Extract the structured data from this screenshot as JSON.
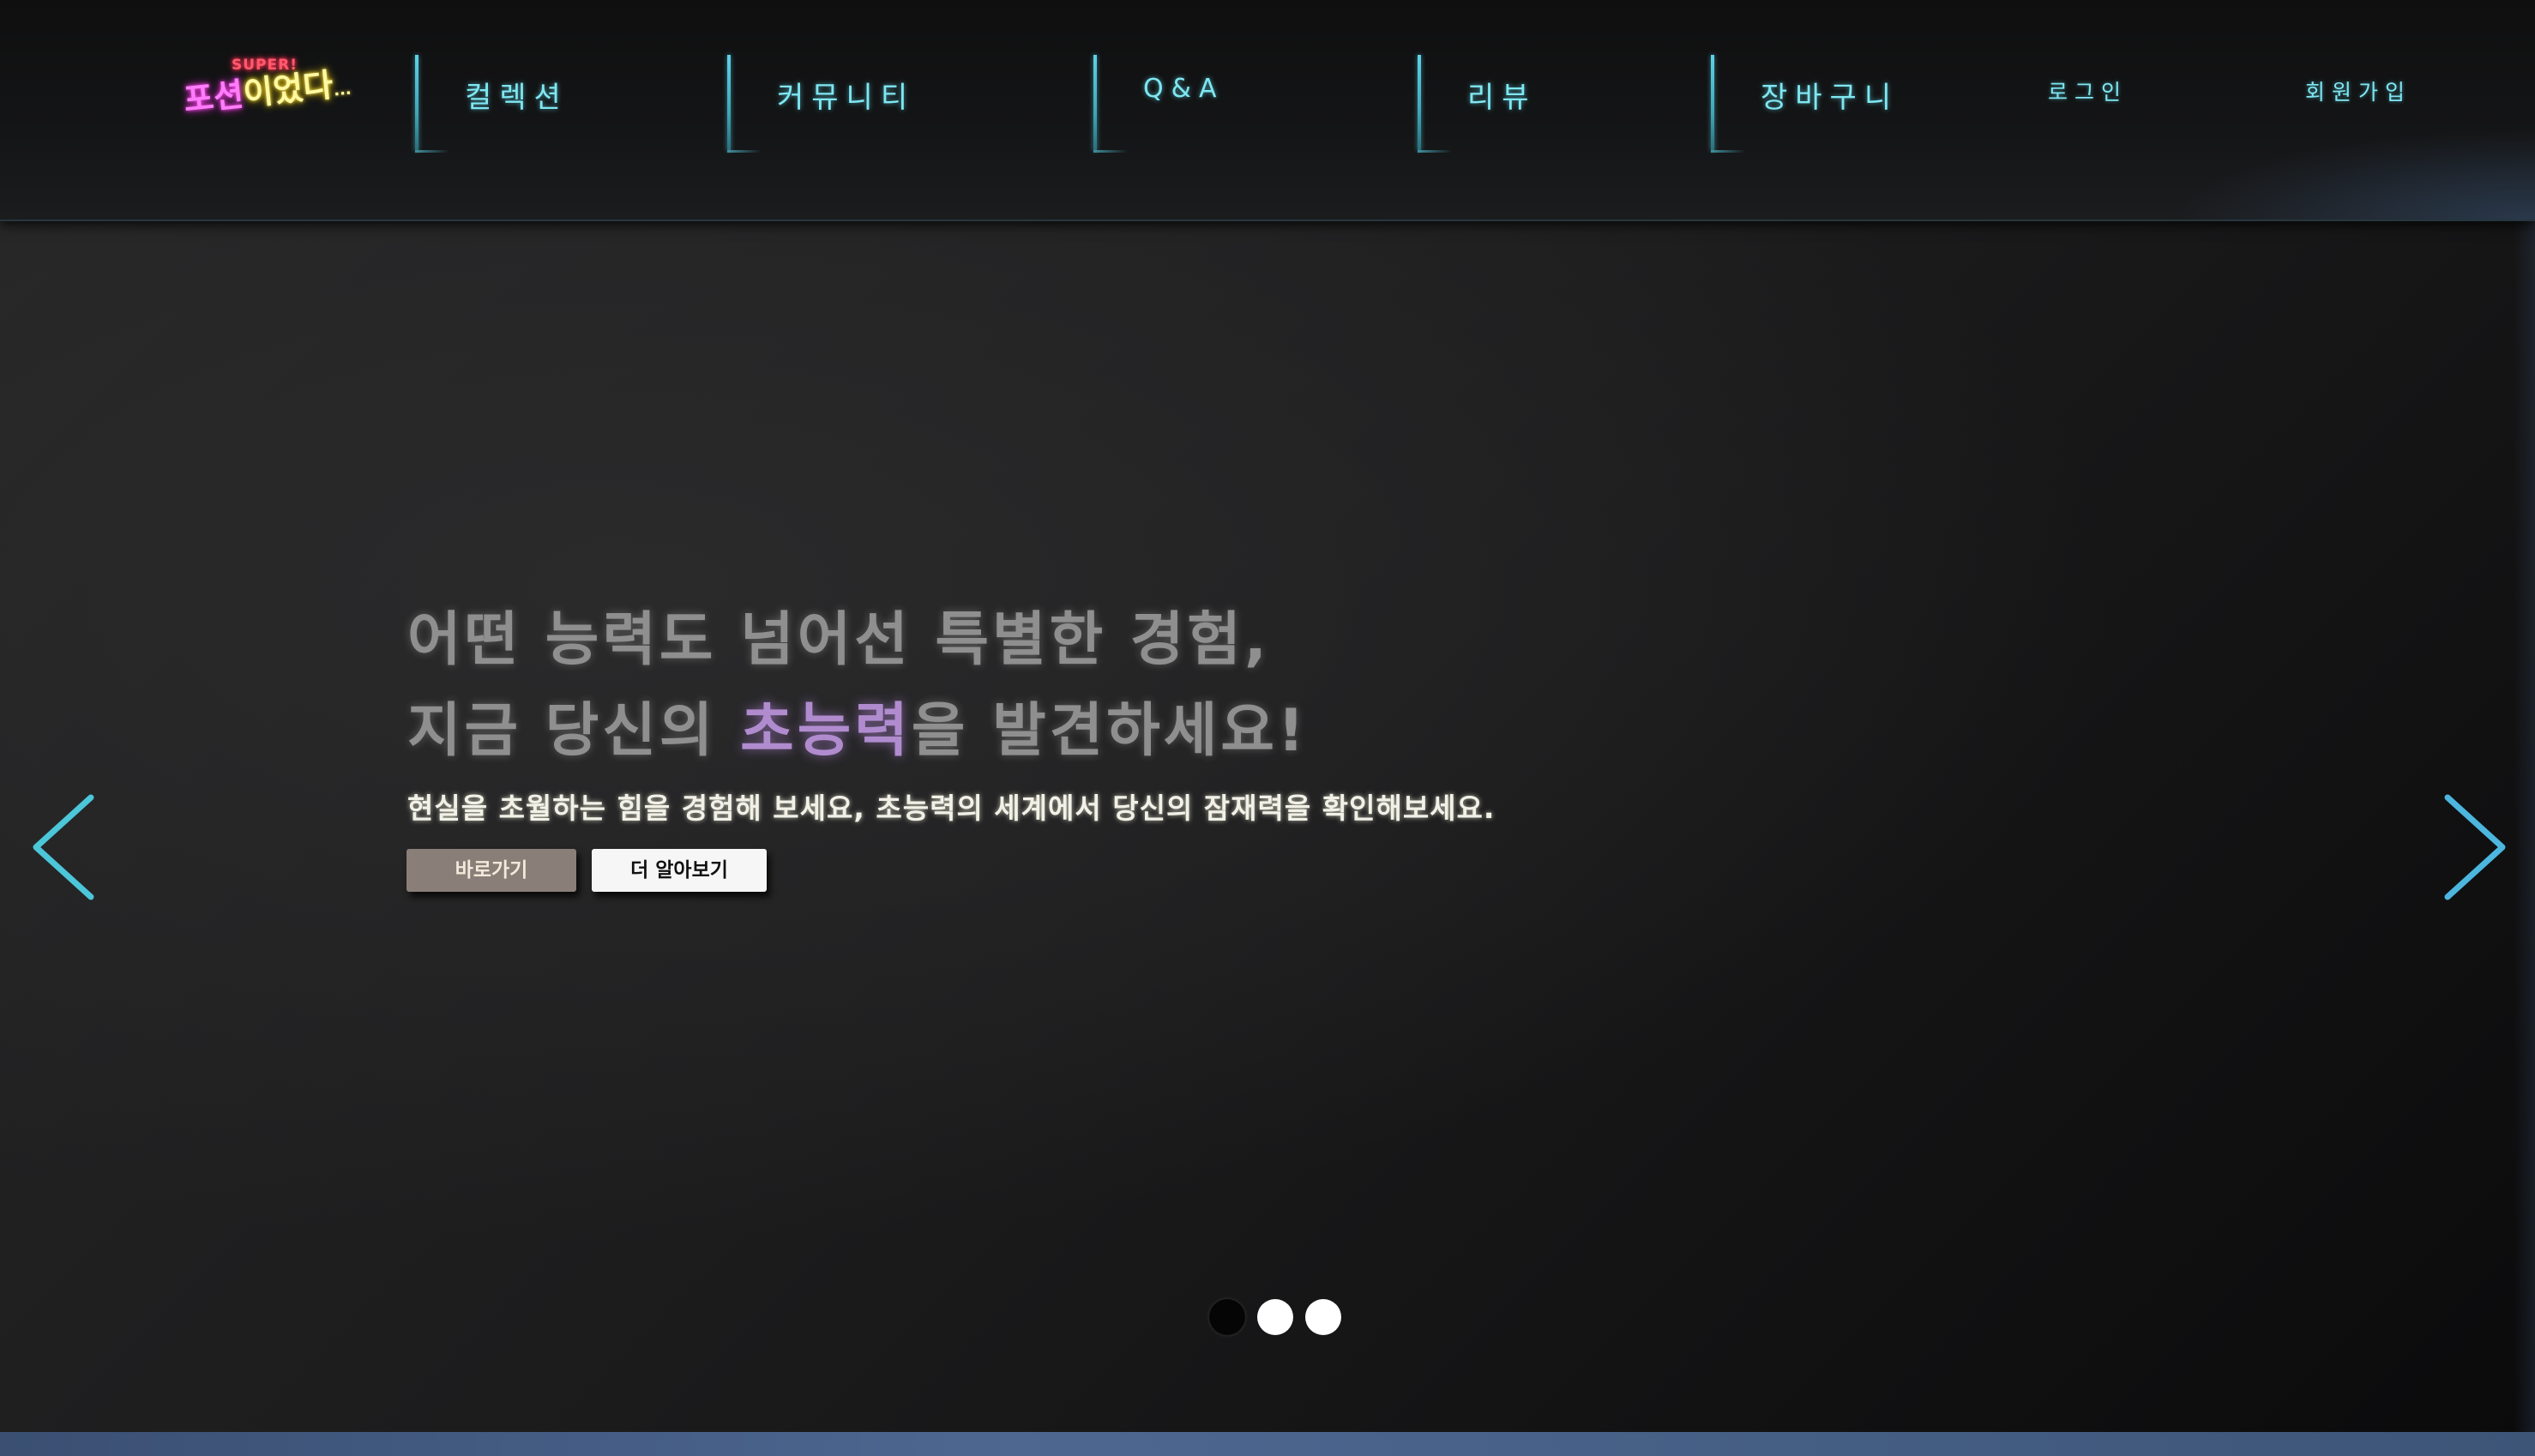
{
  "logo": {
    "super": "SUPER!",
    "part1": "포션",
    "part2": "이었다",
    "dots": "...",
    "colors": {
      "pink": "#ff7dfa",
      "yellow": "#fff9a3",
      "red": "#ff5a6b"
    }
  },
  "nav": {
    "items": [
      {
        "label": "컬렉션"
      },
      {
        "label": "커뮤니티"
      },
      {
        "label": "Q&A"
      },
      {
        "label": "리뷰"
      },
      {
        "label": "장바구니"
      }
    ],
    "login": "로그인",
    "signup": "회원가입",
    "accent_color": "#7fe7f2"
  },
  "hero": {
    "line1": "어떤 능력도 넘어선 특별한 경험,",
    "line2_pre": "지금 당신의 ",
    "line2_accent": "초능력",
    "line2_post": "을 발견하세요!",
    "subtitle": "현실을 초월하는 힘을 경험해 보세요, 초능력의 세계에서 당신의 잠재력을 확인해보세요.",
    "primary_button": "바로가기",
    "secondary_button": "더 알아보기",
    "accent_color": "#b08ccf"
  },
  "carousel": {
    "prev_icon": "chevron-left-icon",
    "next_icon": "chevron-right-icon",
    "slide_count": 3,
    "active_index": 0
  }
}
